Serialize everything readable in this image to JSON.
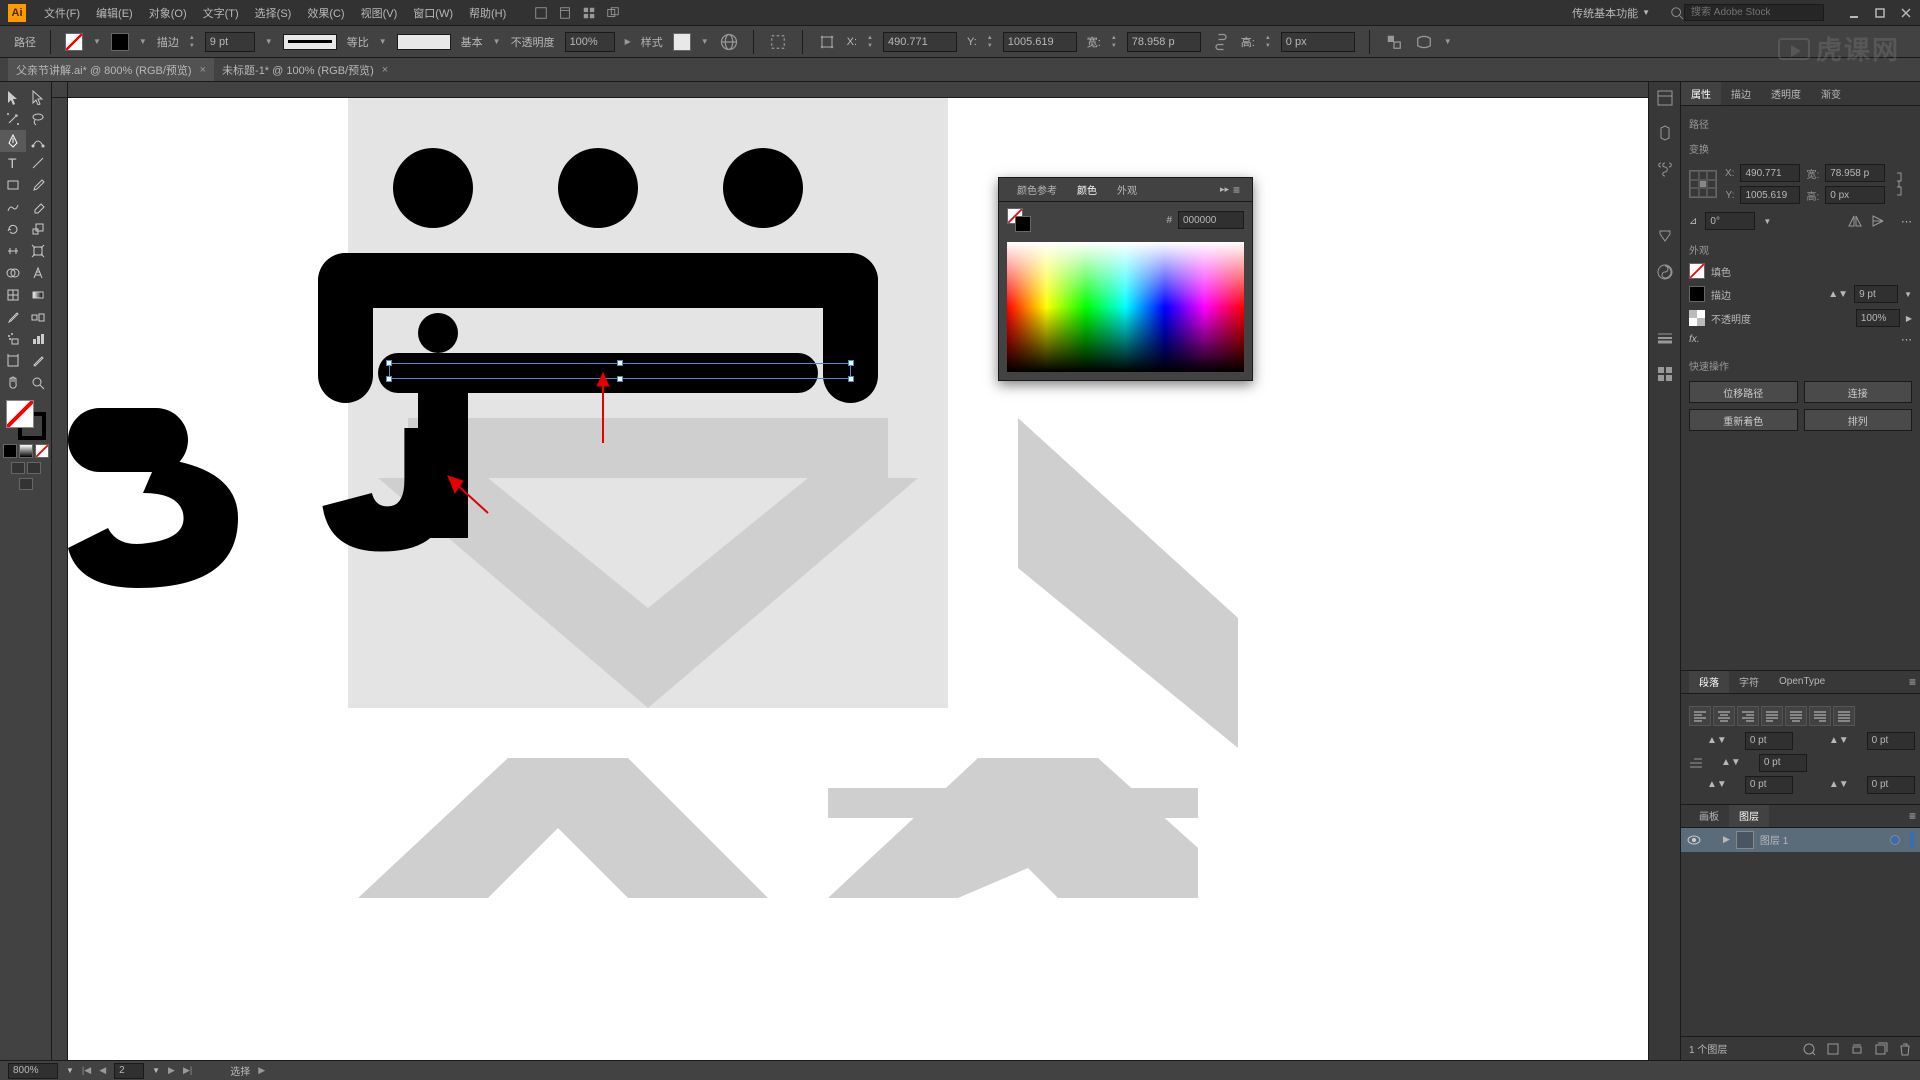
{
  "menu": {
    "file": "文件(F)",
    "edit": "编辑(E)",
    "object": "对象(O)",
    "type": "文字(T)",
    "select": "选择(S)",
    "effect": "效果(C)",
    "view": "视图(V)",
    "window": "窗口(W)",
    "help": "帮助(H)"
  },
  "workspace": "传统基本功能",
  "search_placeholder": "搜索 Adobe Stock",
  "controlbar": {
    "mode": "路径",
    "stroke_label": "描边",
    "stroke_weight": "9 pt",
    "stroke_profile": "等比",
    "brush": "基本",
    "opacity_label": "不透明度",
    "opacity_value": "100%",
    "style_label": "样式",
    "x_label": "X:",
    "x_value": "490.771",
    "y_label": "Y:",
    "y_value": "1005.619",
    "w_label": "宽:",
    "w_value": "78.958 p",
    "h_label": "高:",
    "h_value": "0 px"
  },
  "tabs": [
    {
      "title": "父亲节讲解.ai* @ 800% (RGB/预览)",
      "active": true
    },
    {
      "title": "未标题-1* @ 100% (RGB/预览)",
      "active": false
    }
  ],
  "color_panel": {
    "tab_ref": "颜色参考",
    "tab_color": "颜色",
    "tab_appearance": "外观",
    "hex_value": "000000"
  },
  "properties": {
    "tab_props": "属性",
    "tab_stroke": "描边",
    "tab_transparency": "透明度",
    "tab_gradient": "渐变",
    "section_path": "路径",
    "section_transform": "变换",
    "x": "490.771",
    "y": "1005.619",
    "w": "78.958 p",
    "h": "0 px",
    "rotate": "0°",
    "section_appearance": "外观",
    "fill_label": "填色",
    "stroke_label": "描边",
    "stroke_value": "9 pt",
    "opacity_label": "不透明度",
    "opacity_value": "100%",
    "fx": "fx.",
    "section_quick": "快速操作",
    "btn_offset": "位移路径",
    "btn_link": "连接",
    "btn_recolor": "重新着色",
    "btn_arrange": "排列"
  },
  "paragraph": {
    "tab_para": "段落",
    "tab_char": "字符",
    "tab_opentype": "OpenType",
    "indent_left": "0 pt",
    "indent_right": "0 pt",
    "indent_first": "0 pt",
    "space_before": "0 pt",
    "space_after": "0 pt"
  },
  "layers": {
    "tab_artboards": "画板",
    "tab_layers": "图层",
    "layer1_name": "图层 1",
    "footer_count": "1 个图层"
  },
  "statusbar": {
    "zoom": "800%",
    "artboard_num": "2",
    "tool": "选择"
  },
  "watermark": "虎课网"
}
